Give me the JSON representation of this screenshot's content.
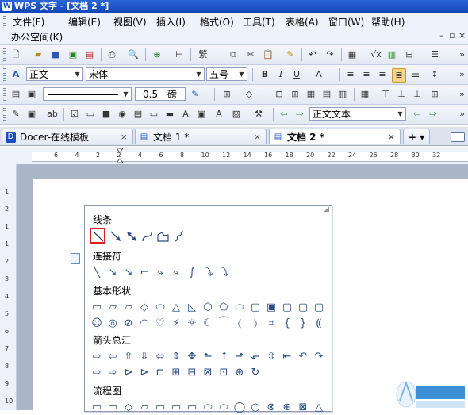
{
  "window": {
    "title": "WPS 文字 - [文档 2 *]"
  },
  "menu": {
    "items": [
      "文件(F)",
      "编辑(E)",
      "视图(V)",
      "插入(I)",
      "格式(O)",
      "工具(T)",
      "表格(A)",
      "窗口(W)",
      "帮助(H)"
    ],
    "second_row": "办公空间(K)"
  },
  "format_toolbar": {
    "style": "正文",
    "font": "宋体",
    "size": "五号"
  },
  "draw_toolbar": {
    "line_weight": "0.5",
    "line_unit": "磅",
    "style_box": "正文文本"
  },
  "tabs": [
    {
      "label": "Docer-在线模板",
      "active": false
    },
    {
      "label": "文档 1 *",
      "active": false
    },
    {
      "label": "文档 2 *",
      "active": true
    }
  ],
  "ruler_numbers": [
    "6",
    "4",
    "2",
    "2",
    "4",
    "6",
    "8",
    "10",
    "12",
    "14",
    "16",
    "18",
    "20",
    "22",
    "24",
    "26",
    "28",
    "30",
    "32"
  ],
  "left_ruler_numbers": [
    "1",
    "2",
    "1",
    "1",
    "2",
    "3",
    "4",
    "5",
    "6",
    "7",
    "8",
    "9",
    "10"
  ],
  "shapes_panel": {
    "sections": [
      "线条",
      "连接符",
      "基本形状",
      "箭头总汇",
      "流程图"
    ]
  },
  "colors": {
    "title_bar": "#1b4ec0",
    "selection": "#dd2222",
    "shape_stroke": "#2a4c86"
  }
}
